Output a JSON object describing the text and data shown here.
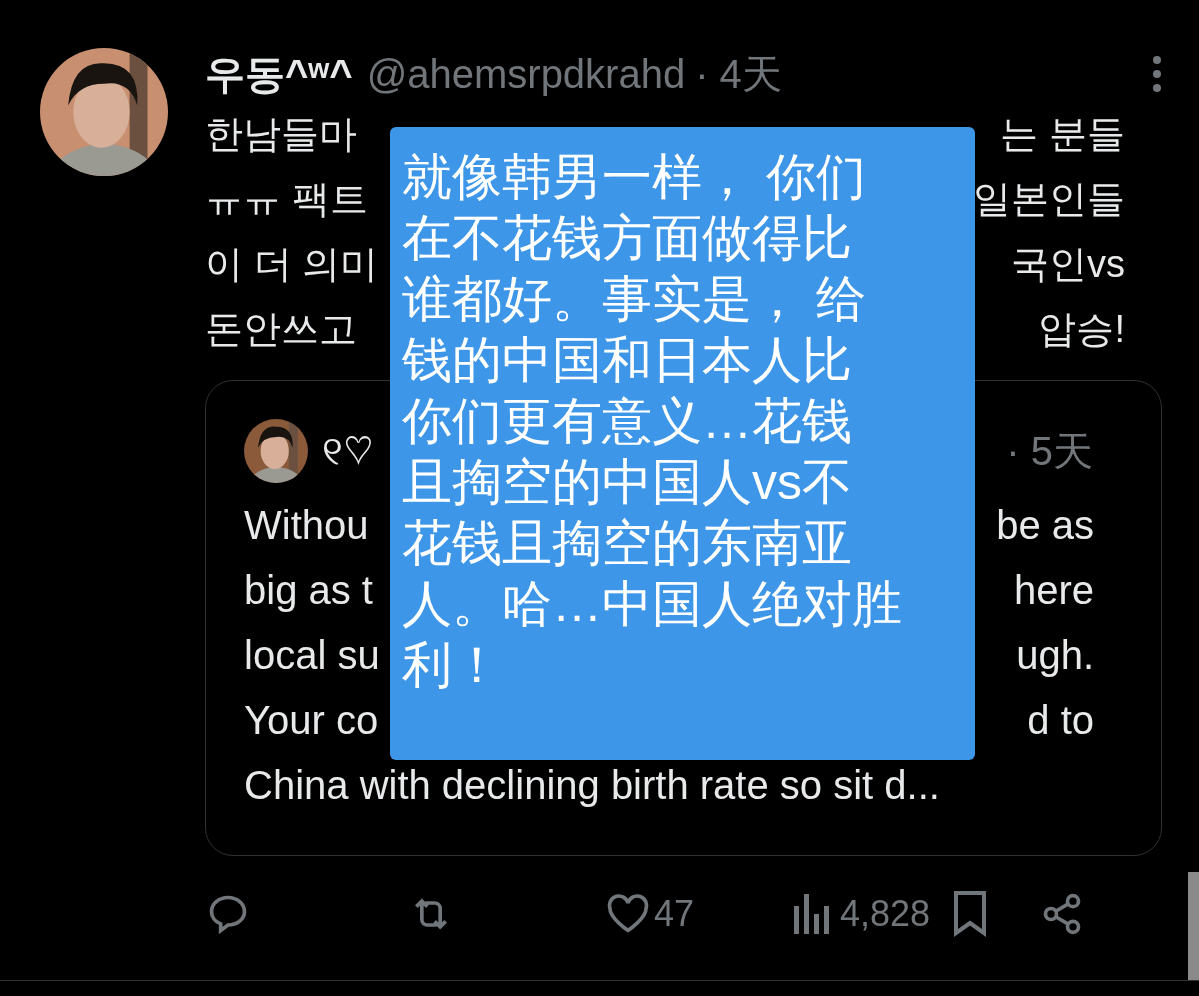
{
  "post": {
    "display_name": "우동^ʷ^",
    "handle": "@ahemsrpdkrahd",
    "time": "· 4天",
    "text_lines": [
      {
        "left": "한남들마",
        "right": "는 분들"
      },
      {
        "left": "ㅠㅠ 팩트",
        "right": "일본인들"
      },
      {
        "left": "이 더 의미",
        "right": "국인vs"
      },
      {
        "left": "돈안쓰고",
        "right": "압승!"
      }
    ],
    "quote": {
      "display_name": "୧♡",
      "time": "· 5天",
      "text_lines": [
        {
          "left": "Withou",
          "right": "be as"
        },
        {
          "left": "big as t",
          "right": "here"
        },
        {
          "left": "local su",
          "right": "ugh."
        },
        {
          "left": "Your co",
          "right": "d to"
        },
        {
          "left": "China with declining birth rate so sit d..."
        }
      ]
    },
    "actions": {
      "likes": "47",
      "views": "4,828"
    }
  },
  "translation_overlay": {
    "lines": [
      "就像韩男一样， 你们",
      "在不花钱方面做得比",
      "谁都好。事实是， 给",
      "钱的中国和日本人比",
      "你们更有意义…花钱",
      "且掏空的中国人vs不",
      "花钱且掏空的东南亚",
      "人。哈…中国人绝对胜",
      "利！"
    ]
  }
}
